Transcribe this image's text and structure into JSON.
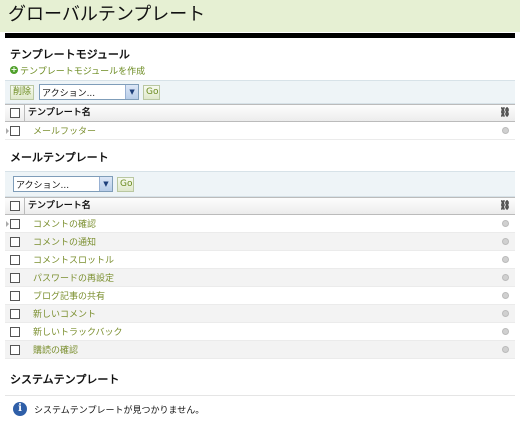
{
  "page": {
    "title": "グローバルテンプレート"
  },
  "template_modules": {
    "title": "テンプレートモジュール",
    "create_link": "テンプレートモジュールを作成",
    "delete_button": "削除",
    "action_select": "アクション...",
    "go_button": "Go",
    "column_name": "テンプレート名",
    "rows": [
      {
        "name": "メールフッター"
      }
    ]
  },
  "mail_templates": {
    "title": "メールテンプレート",
    "action_select": "アクション...",
    "go_button": "Go",
    "column_name": "テンプレート名",
    "rows": [
      {
        "name": "コメントの確認"
      },
      {
        "name": "コメントの通知"
      },
      {
        "name": "コメントスロットル"
      },
      {
        "name": "パスワードの再設定"
      },
      {
        "name": "ブログ記事の共有"
      },
      {
        "name": "新しいコメント"
      },
      {
        "name": "新しいトラックバック"
      },
      {
        "name": "購読の確認"
      }
    ]
  },
  "system_templates": {
    "title": "システムテンプレート",
    "empty_message": "システムテンプレートが見つかりません。"
  },
  "icons": {
    "plus": "plus-circle-icon",
    "link": "chain-link-icon",
    "info": "info-icon",
    "published": "status-dot-icon"
  }
}
